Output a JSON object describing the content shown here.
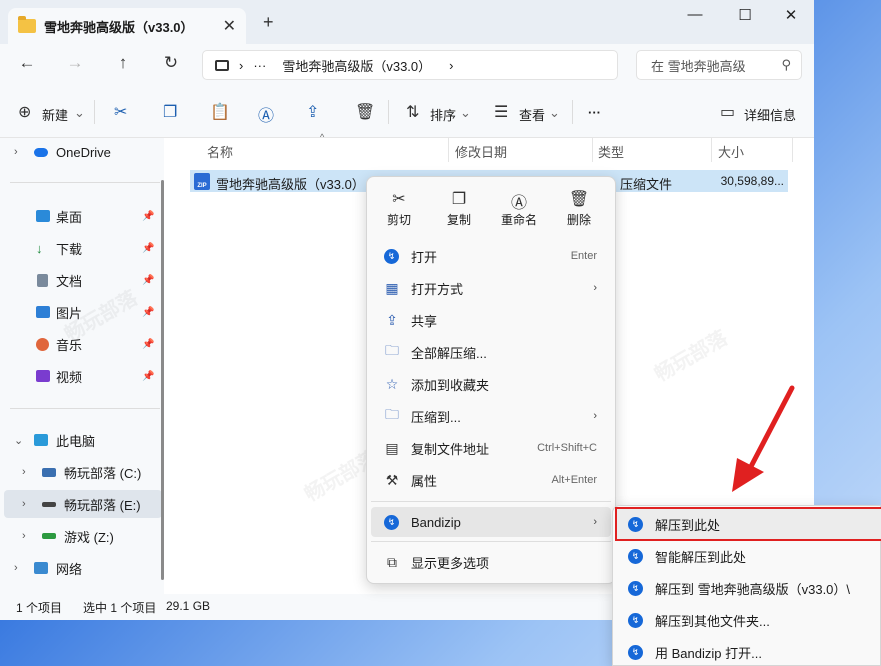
{
  "window": {
    "tab_title": "雪地奔驰高级版（v33.0）",
    "tab_close": "✕",
    "new_tab": "+",
    "min": "—",
    "max": "☐",
    "close": "✕"
  },
  "nav": {
    "back": "←",
    "forward": "→",
    "up": "↑",
    "refresh": "↻",
    "path_sep": "›",
    "path_more": "···",
    "path_folder": "雪地奔驰高级版（v33.0）",
    "path_chevron": "›",
    "search_placeholder": "在 雪地奔驰高级",
    "search_icon": "⚲"
  },
  "toolbar": {
    "new_label": "新建",
    "new_icon": "⊕",
    "sort_label": "排序",
    "view_label": "查看",
    "more": "···",
    "details_label": "详细信息",
    "dropdown": "⌄"
  },
  "sidebar": {
    "onedrive": "OneDrive",
    "desktop": "桌面",
    "downloads": "下载",
    "documents": "文档",
    "pictures": "图片",
    "music": "音乐",
    "videos": "视频",
    "thispc": "此电脑",
    "drive_c": "畅玩部落 (C:)",
    "drive_e": "畅玩部落 (E:)",
    "drive_z": "游戏 (Z:)",
    "network": "网络",
    "pin": "📌",
    "chev_right": "›",
    "chev_down": "⌄"
  },
  "columns": {
    "name": "名称",
    "date": "修改日期",
    "type": "类型",
    "size": "大小",
    "sort_arrow": "^"
  },
  "file": {
    "name": "雪地奔驰高级版（v33.0）",
    "type": "压缩文件",
    "size": "30,598,89...",
    "badge": "ZIP"
  },
  "status": {
    "count": "1 个项目",
    "selected": "选中 1 个项目",
    "size": "29.1 GB"
  },
  "context_menu": {
    "cut": "剪切",
    "copy": "复制",
    "rename": "重命名",
    "delete": "删除",
    "open": "打开",
    "open_shortcut": "Enter",
    "open_with": "打开方式",
    "share": "共享",
    "extract_all": "全部解压缩...",
    "add_favorites": "添加到收藏夹",
    "compress_to": "压缩到...",
    "copy_path": "复制文件地址",
    "copy_path_shortcut": "Ctrl+Shift+C",
    "properties": "属性",
    "properties_shortcut": "Alt+Enter",
    "bandizip": "Bandizip",
    "show_more": "显示更多选项",
    "submenu_arrow": "›"
  },
  "submenu": {
    "extract_here": "解压到此处",
    "smart_extract": "智能解压到此处",
    "extract_to_folder": "解压到 雪地奔驰高级版（v33.0）\\",
    "extract_other": "解压到其他文件夹...",
    "open_with_bandizip": "用 Bandizip 打开..."
  },
  "colors": {
    "accent": "#1d5fb0",
    "selection": "#cce4f7",
    "highlight_box": "#e02020",
    "bandizip_blue": "#1668d8"
  }
}
